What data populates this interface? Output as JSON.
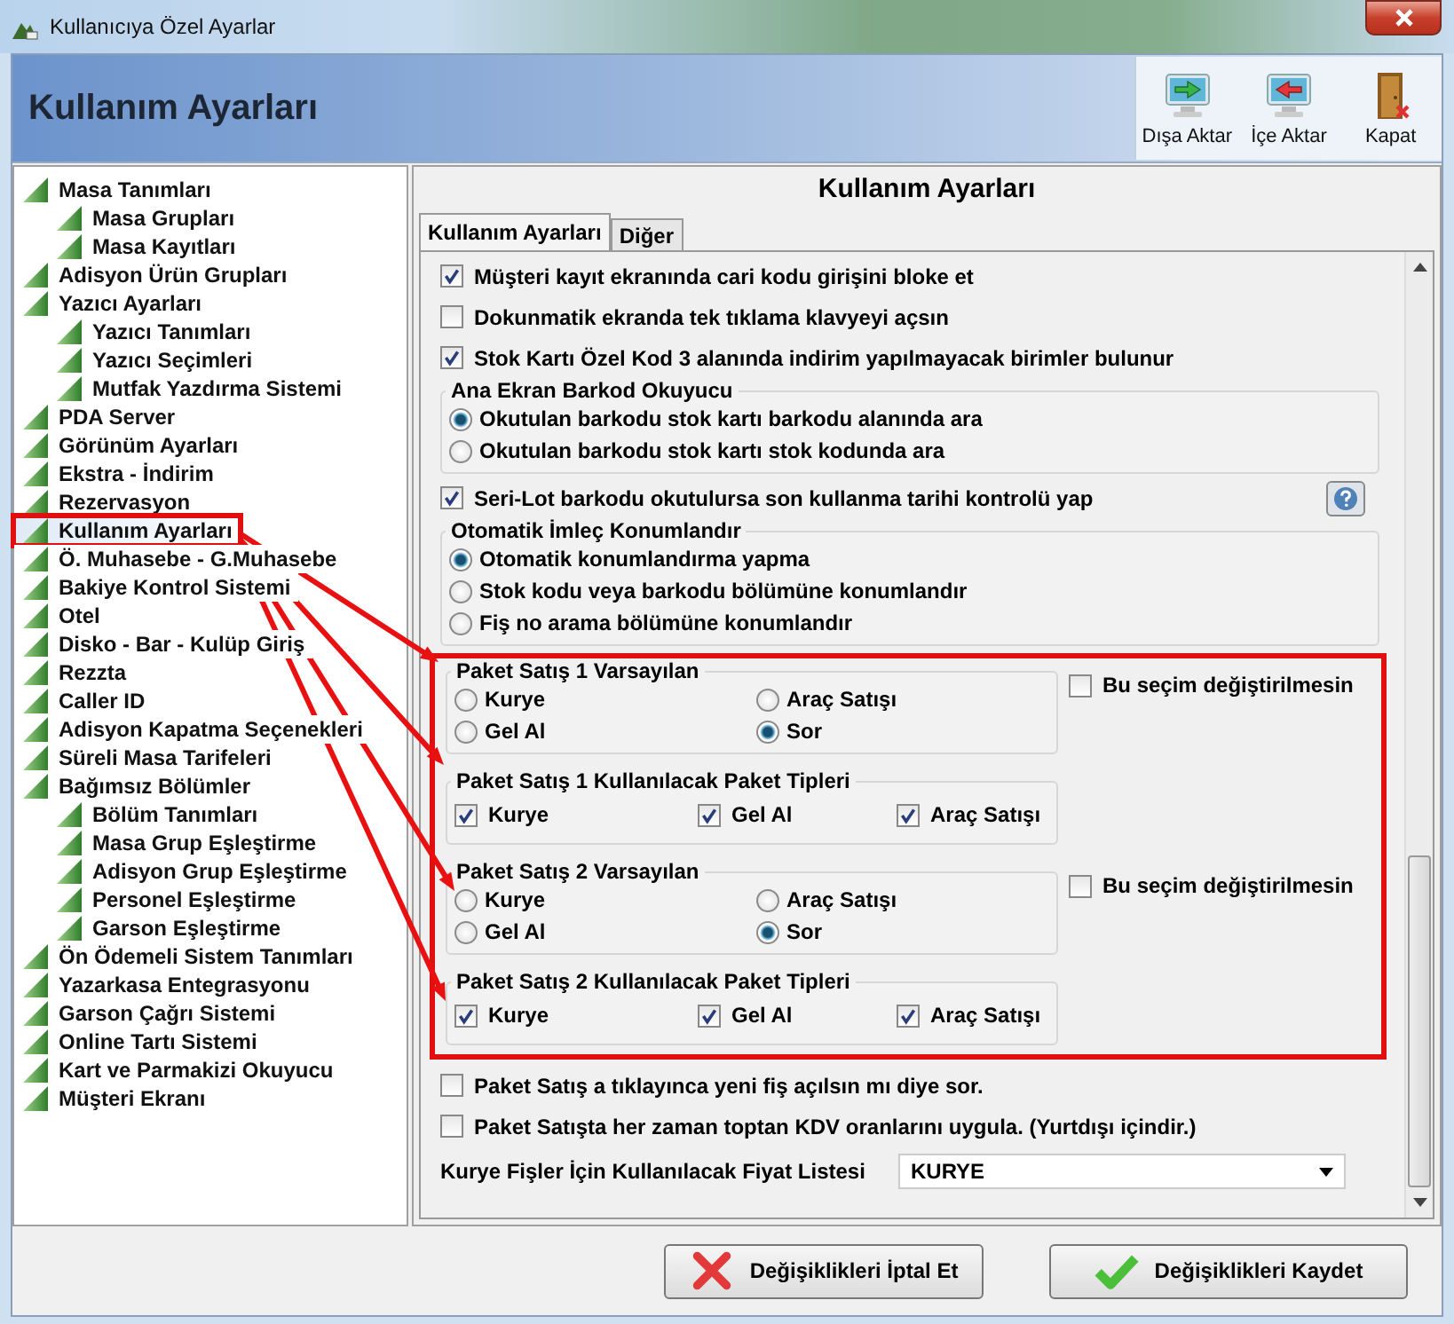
{
  "window": {
    "title": "Kullanıcıya Özel Ayarlar"
  },
  "header": {
    "title": "Kullanım Ayarları",
    "toolbar": [
      {
        "label": "Dışa Aktar",
        "kind": "export"
      },
      {
        "label": "İçe Aktar",
        "kind": "import"
      },
      {
        "label": "Kapat",
        "kind": "close"
      }
    ]
  },
  "tree": [
    {
      "label": "Masa Tanımları",
      "selected": false,
      "highlighted": false,
      "children": [
        {
          "label": "Masa Grupları",
          "selected": false,
          "highlighted": false
        },
        {
          "label": "Masa Kayıtları",
          "selected": false,
          "highlighted": false
        }
      ]
    },
    {
      "label": "Adisyon Ürün Grupları",
      "selected": false,
      "highlighted": false
    },
    {
      "label": "Yazıcı Ayarları",
      "selected": false,
      "highlighted": false,
      "children": [
        {
          "label": "Yazıcı Tanımları",
          "selected": false,
          "highlighted": false
        },
        {
          "label": "Yazıcı Seçimleri",
          "selected": false,
          "highlighted": false
        },
        {
          "label": "Mutfak Yazdırma Sistemi",
          "selected": false,
          "highlighted": false
        }
      ]
    },
    {
      "label": "PDA Server",
      "selected": false,
      "highlighted": false
    },
    {
      "label": "Görünüm Ayarları",
      "selected": false,
      "highlighted": false
    },
    {
      "label": "Ekstra - İndirim",
      "selected": false,
      "highlighted": false
    },
    {
      "label": "Rezervasyon",
      "selected": false,
      "highlighted": false
    },
    {
      "label": "Kullanım Ayarları",
      "selected": true,
      "highlighted": true
    },
    {
      "label": "Ö. Muhasebe - G.Muhasebe",
      "selected": false,
      "highlighted": false
    },
    {
      "label": "Bakiye Kontrol Sistemi",
      "selected": false,
      "highlighted": false
    },
    {
      "label": "Otel",
      "selected": false,
      "highlighted": false
    },
    {
      "label": "Disko - Bar - Kulüp Giriş",
      "selected": false,
      "highlighted": false
    },
    {
      "label": "Rezzta",
      "selected": false,
      "highlighted": false
    },
    {
      "label": "Caller ID",
      "selected": false,
      "highlighted": false
    },
    {
      "label": "Adisyon Kapatma Seçenekleri",
      "selected": false,
      "highlighted": false
    },
    {
      "label": "Süreli Masa Tarifeleri",
      "selected": false,
      "highlighted": false
    },
    {
      "label": "Bağımsız Bölümler",
      "selected": false,
      "highlighted": false,
      "children": [
        {
          "label": "Bölüm Tanımları",
          "selected": false,
          "highlighted": false
        },
        {
          "label": "Masa Grup Eşleştirme",
          "selected": false,
          "highlighted": false
        },
        {
          "label": "Adisyon Grup Eşleştirme",
          "selected": false,
          "highlighted": false
        },
        {
          "label": "Personel Eşleştirme",
          "selected": false,
          "highlighted": false
        },
        {
          "label": "Garson Eşleştirme",
          "selected": false,
          "highlighted": false
        }
      ]
    },
    {
      "label": "Ön Ödemeli Sistem Tanımları",
      "selected": false,
      "highlighted": false
    },
    {
      "label": "Yazarkasa Entegrasyonu",
      "selected": false,
      "highlighted": false
    },
    {
      "label": "Garson Çağrı Sistemi",
      "selected": false,
      "highlighted": false
    },
    {
      "label": "Online Tartı Sistemi",
      "selected": false,
      "highlighted": false
    },
    {
      "label": "Kart ve Parmakizi Okuyucu",
      "selected": false,
      "highlighted": false
    },
    {
      "label": "Müşteri Ekranı",
      "selected": false,
      "highlighted": false
    }
  ],
  "panel": {
    "title": "Kullanım Ayarları",
    "tabs": [
      {
        "label": "Kullanım Ayarları",
        "selected": true
      },
      {
        "label": "Diğer",
        "selected": false
      }
    ],
    "items": [
      {
        "kind": "checkbox",
        "label": "Müşteri kayıt ekranında cari kodu girişini bloke et",
        "checked": true
      },
      {
        "kind": "checkbox",
        "label": "Dokunmatik ekranda tek tıklama klavyeyi açsın",
        "checked": false
      },
      {
        "kind": "checkbox",
        "label": "Stok Kartı Özel Kod 3 alanında indirim yapılmayacak birimler bulunur",
        "checked": true
      },
      {
        "kind": "radio_group",
        "title": "Ana Ekran Barkod Okuyucu",
        "options": [
          {
            "label": "Okutulan barkodu stok kartı barkodu alanında ara",
            "selected": true
          },
          {
            "label": "Okutulan barkodu stok kartı stok kodunda ara",
            "selected": false
          }
        ]
      },
      {
        "kind": "checkbox",
        "label": "Seri-Lot barkodu okutulursa son kullanma tarihi kontrolü yap",
        "checked": true,
        "help": true
      },
      {
        "kind": "radio_group",
        "title": "Otomatik İmleç Konumlandır",
        "options": [
          {
            "label": "Otomatik konumlandırma yapma",
            "selected": true
          },
          {
            "label": "Stok kodu veya barkodu bölümüne konumlandır",
            "selected": false
          },
          {
            "label": "Fiş no arama bölümüne konumlandır",
            "selected": false
          }
        ]
      },
      {
        "kind": "section",
        "highlighted": true,
        "groups": [
          {
            "kind": "radio_grid",
            "title": "Paket Satış 1 Varsayılan",
            "options": [
              {
                "label": "Kurye",
                "selected": false
              },
              {
                "label": "Araç Satışı",
                "selected": false
              },
              {
                "label": "Gel Al",
                "selected": false
              },
              {
                "label": "Sor",
                "selected": true
              }
            ],
            "lock": {
              "label": "Bu seçim değiştirilmesin",
              "checked": false
            }
          },
          {
            "kind": "check_row",
            "title": "Paket Satış 1 Kullanılacak Paket Tipleri",
            "options": [
              {
                "label": "Kurye",
                "checked": true
              },
              {
                "label": "Gel Al",
                "checked": true
              },
              {
                "label": "Araç Satışı",
                "checked": true
              }
            ]
          },
          {
            "kind": "radio_grid",
            "title": "Paket Satış 2 Varsayılan",
            "options": [
              {
                "label": "Kurye",
                "selected": false
              },
              {
                "label": "Araç Satışı",
                "selected": false
              },
              {
                "label": "Gel Al",
                "selected": false
              },
              {
                "label": "Sor",
                "selected": true
              }
            ],
            "lock": {
              "label": "Bu seçim değiştirilmesin",
              "checked": false
            }
          },
          {
            "kind": "check_row",
            "title": "Paket Satış 2 Kullanılacak Paket Tipleri",
            "options": [
              {
                "label": "Kurye",
                "checked": true
              },
              {
                "label": "Gel Al",
                "checked": true
              },
              {
                "label": "Araç Satışı",
                "checked": true
              }
            ]
          }
        ]
      },
      {
        "kind": "checkbox",
        "label": "Paket Satış a tıklayınca yeni fiş açılsın mı diye sor.",
        "checked": false
      },
      {
        "kind": "checkbox",
        "label": "Paket Satışta her zaman toptan KDV oranlarını uygula. (Yurtdışı içindir.)",
        "checked": false
      },
      {
        "kind": "select",
        "label": "Kurye Fişler İçin Kullanılacak Fiyat Listesi",
        "value": "KURYE"
      }
    ]
  },
  "buttons": [
    {
      "label": "Değişiklikleri İptal Et",
      "kind": "cancel"
    },
    {
      "label": "Değişiklikleri Kaydet",
      "kind": "save"
    }
  ]
}
